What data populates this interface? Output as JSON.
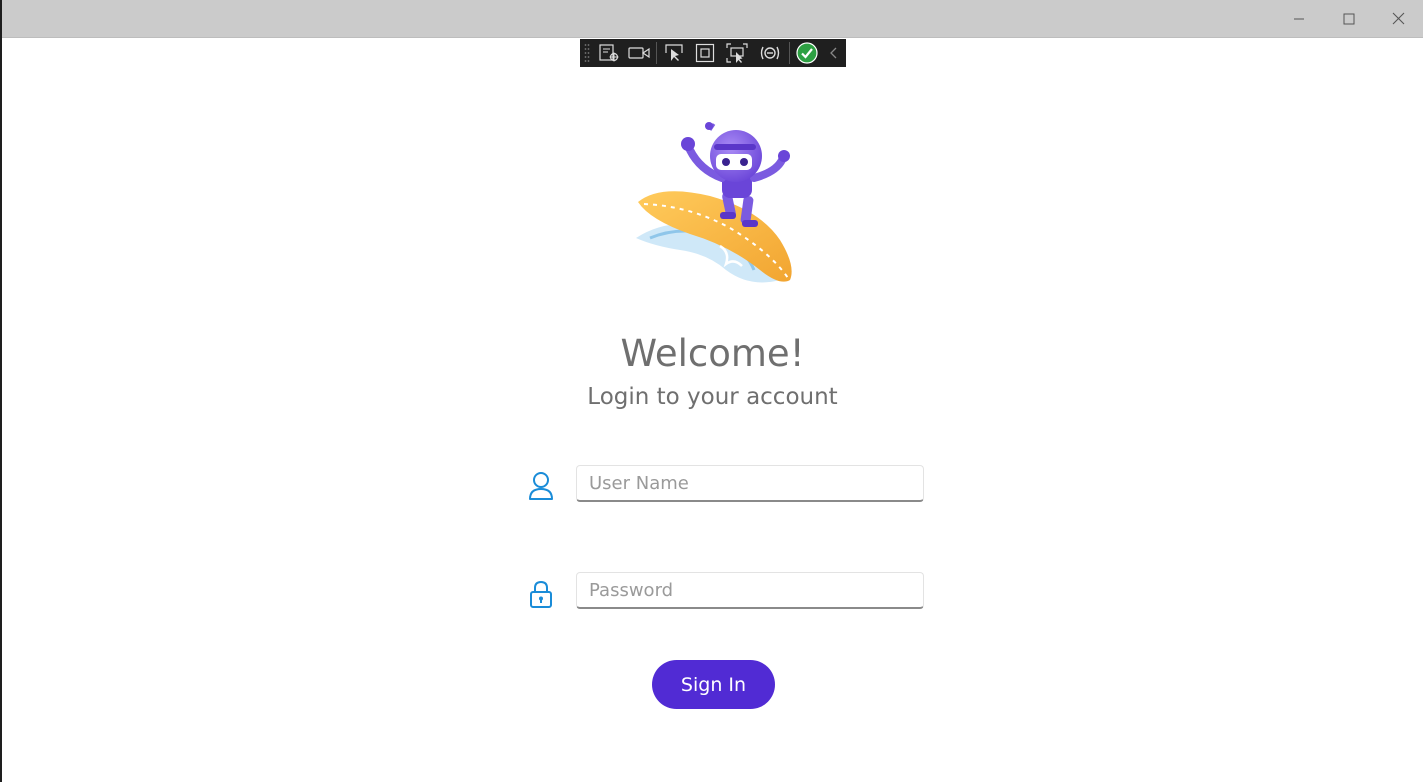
{
  "window": {
    "controls": {
      "minimize_icon": "minimize-icon",
      "maximize_icon": "maximize-icon",
      "close_icon": "close-icon"
    }
  },
  "debug_toolbar": {
    "items": [
      "grip-icon",
      "live-visual-tree-icon",
      "record-icon",
      "select-element-icon",
      "display-layout-adorners-icon",
      "track-focus-icon",
      "binding-failures-icon",
      "hot-reload-ok-icon",
      "collapse-chevron-icon"
    ]
  },
  "login": {
    "welcome": "Welcome!",
    "subtitle": "Login to your account",
    "username_placeholder": "User Name",
    "username_value": "",
    "password_placeholder": "Password",
    "password_value": "",
    "sign_in_label": "Sign In"
  },
  "colors": {
    "accent": "#512bd4",
    "icon_blue": "#1a8cd8",
    "text_gray": "#6f6f6f"
  }
}
